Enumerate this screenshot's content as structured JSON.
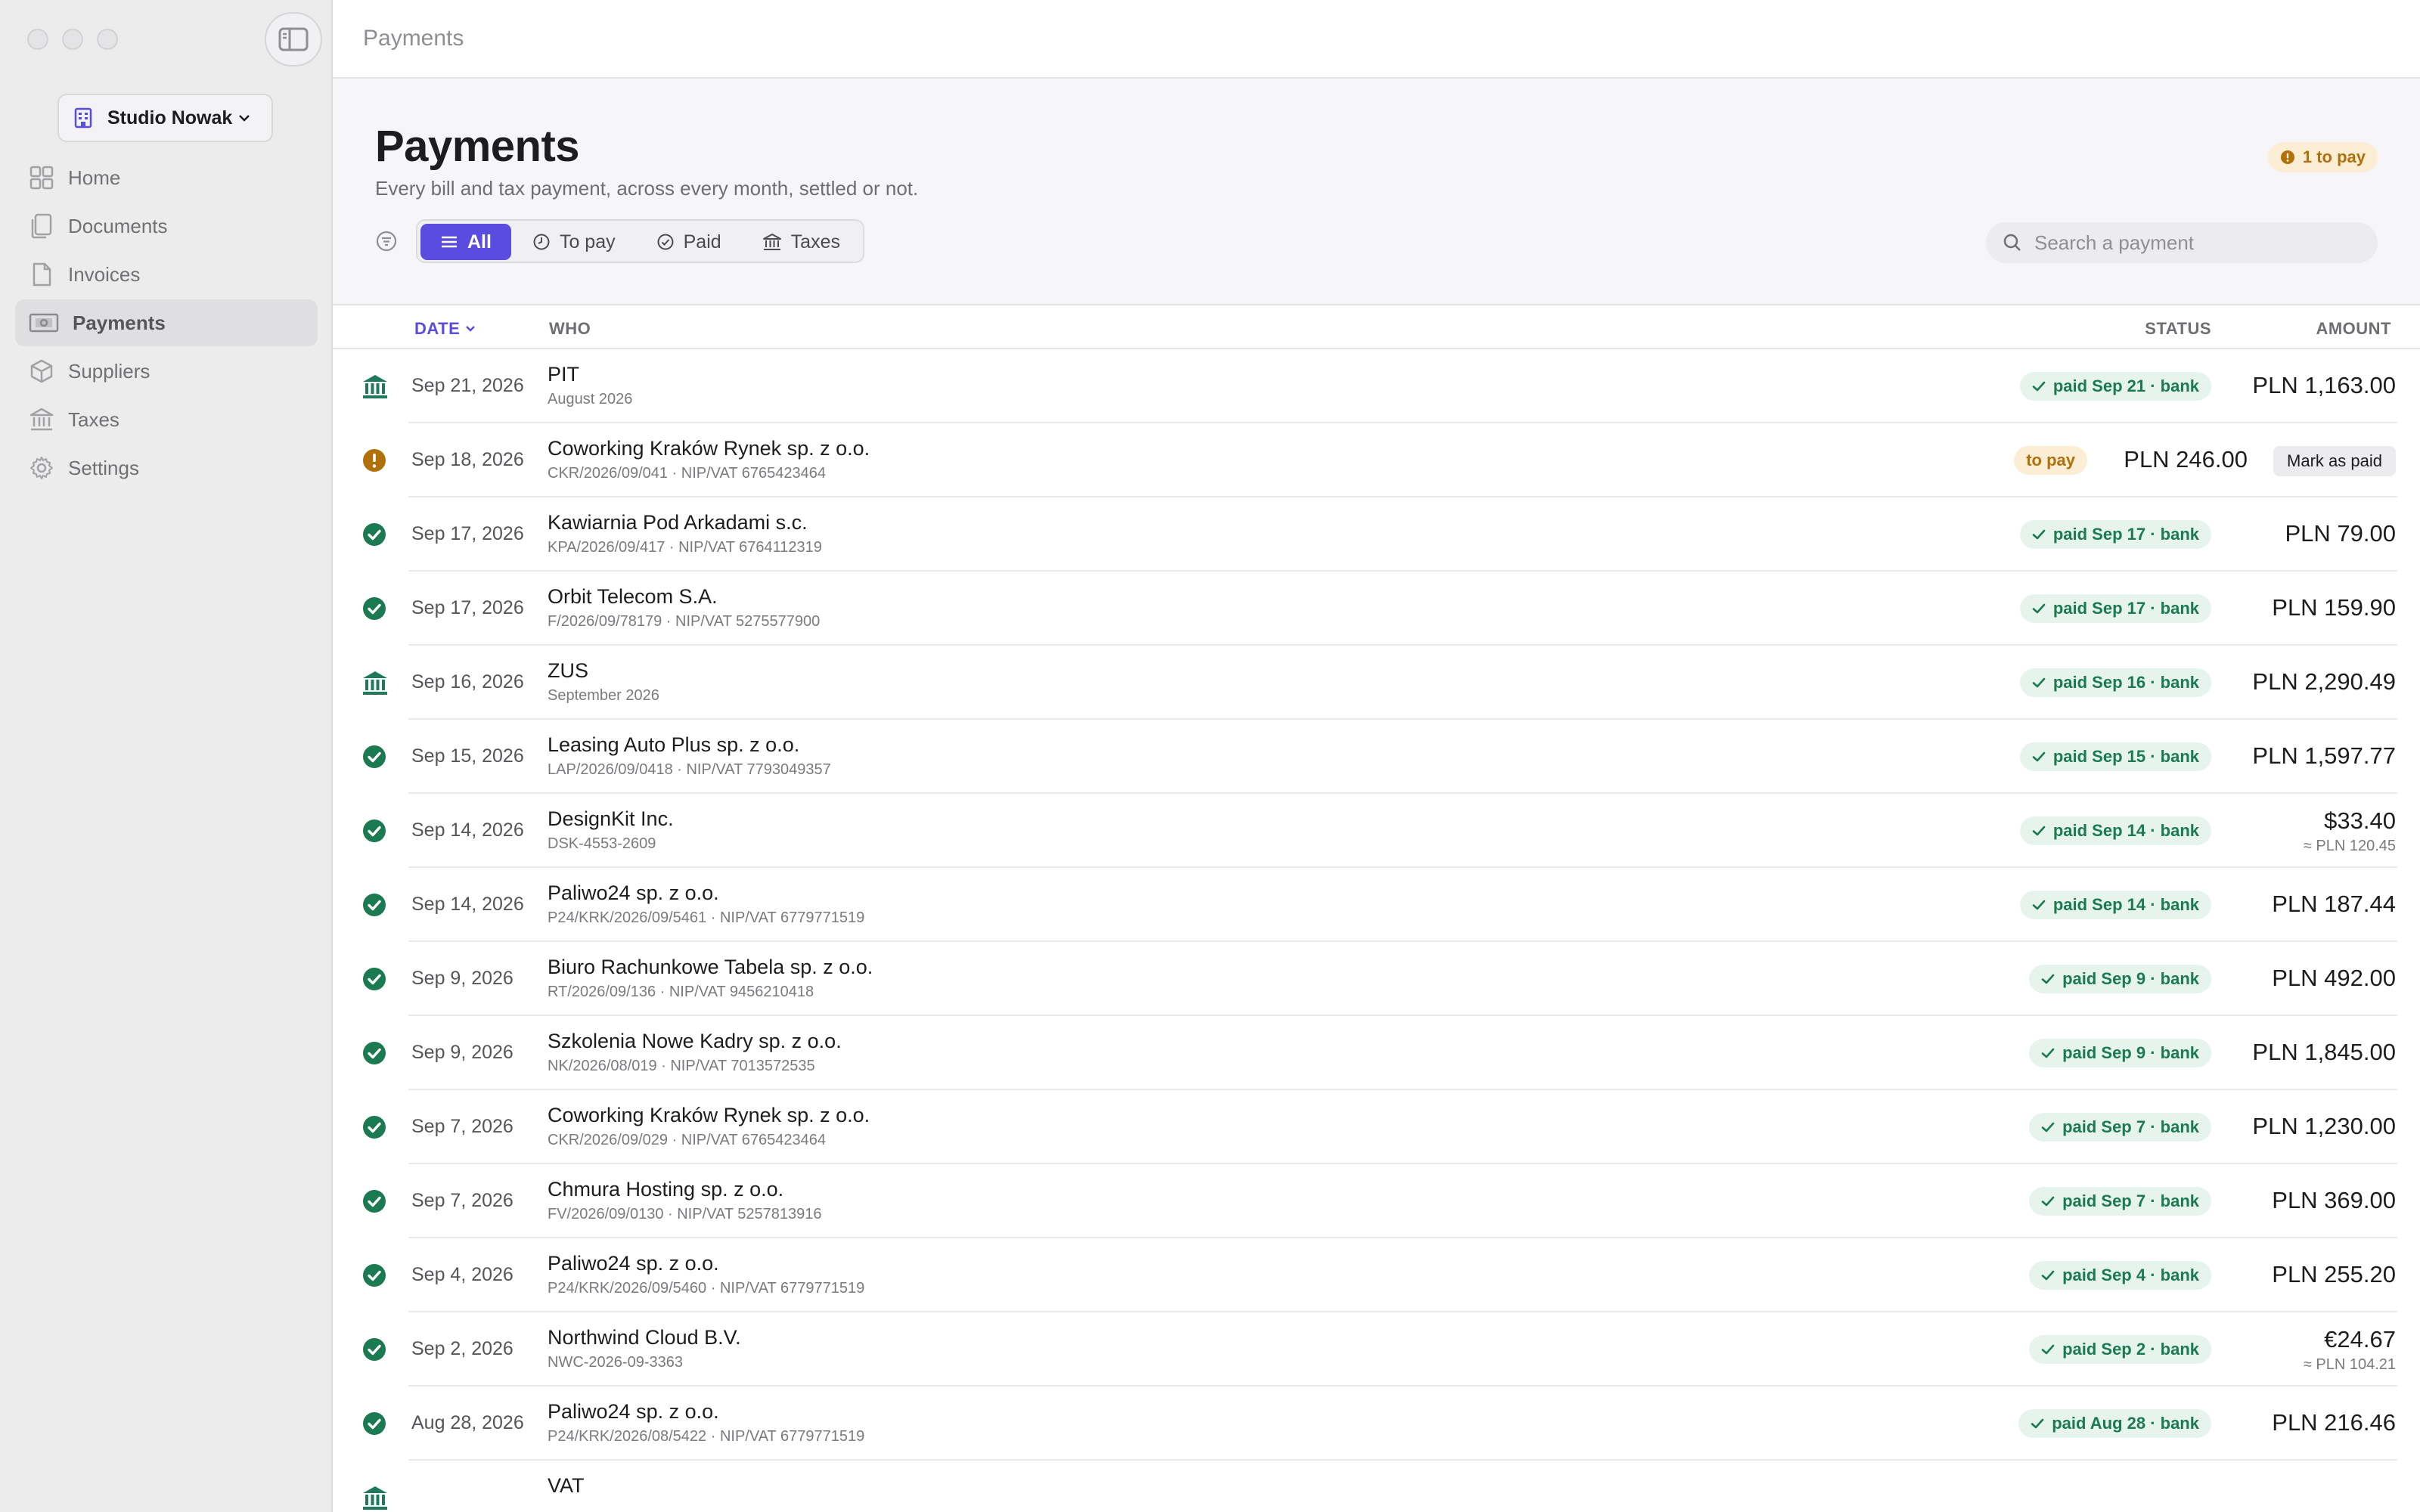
{
  "window": {
    "breadcrumb": "Payments"
  },
  "sidebar": {
    "workspace": "Studio Nowak",
    "items": [
      {
        "label": "Home",
        "icon": "grid-icon"
      },
      {
        "label": "Documents",
        "icon": "documents-icon"
      },
      {
        "label": "Invoices",
        "icon": "invoice-icon"
      },
      {
        "label": "Payments",
        "icon": "banknote-icon",
        "active": true
      },
      {
        "label": "Suppliers",
        "icon": "box-icon"
      },
      {
        "label": "Taxes",
        "icon": "bank-icon"
      },
      {
        "label": "Settings",
        "icon": "gear-icon"
      }
    ]
  },
  "header": {
    "title": "Payments",
    "subtitle": "Every bill and tax payment, across every month, settled or not.",
    "to_pay_badge": "1 to pay",
    "filters": [
      "All",
      "To pay",
      "Paid",
      "Taxes"
    ],
    "search_placeholder": "Search a payment"
  },
  "table": {
    "headers": {
      "date": "DATE",
      "who": "WHO",
      "status": "STATUS",
      "amount": "AMOUNT"
    },
    "mark_paid_label": "Mark as paid",
    "rows": [
      {
        "kind": "tax",
        "date": "Sep 21, 2026",
        "name": "PIT",
        "sub": "August 2026",
        "status": "paid Sep 21 · bank",
        "amount": "PLN 1,163.00"
      },
      {
        "kind": "topay",
        "date": "Sep 18, 2026",
        "name": "Coworking Kraków Rynek sp. z o.o.",
        "sub": "CKR/2026/09/041 · NIP/VAT 6765423464",
        "status": "to pay",
        "amount": "PLN 246.00"
      },
      {
        "kind": "paid",
        "date": "Sep 17, 2026",
        "name": "Kawiarnia Pod Arkadami s.c.",
        "sub": "KPA/2026/09/417 · NIP/VAT 6764112319",
        "status": "paid Sep 17 · bank",
        "amount": "PLN 79.00"
      },
      {
        "kind": "paid",
        "date": "Sep 17, 2026",
        "name": "Orbit Telecom S.A.",
        "sub": "F/2026/09/78179 · NIP/VAT 5275577900",
        "status": "paid Sep 17 · bank",
        "amount": "PLN 159.90"
      },
      {
        "kind": "tax",
        "date": "Sep 16, 2026",
        "name": "ZUS",
        "sub": "September 2026",
        "status": "paid Sep 16 · bank",
        "amount": "PLN 2,290.49"
      },
      {
        "kind": "paid",
        "date": "Sep 15, 2026",
        "name": "Leasing Auto Plus sp. z o.o.",
        "sub": "LAP/2026/09/0418 · NIP/VAT 7793049357",
        "status": "paid Sep 15 · bank",
        "amount": "PLN 1,597.77"
      },
      {
        "kind": "paid",
        "date": "Sep 14, 2026",
        "name": "DesignKit Inc.",
        "sub": "DSK-4553-2609",
        "status": "paid Sep 14 · bank",
        "amount": "$33.40",
        "amount_sub": "≈ PLN 120.45"
      },
      {
        "kind": "paid",
        "date": "Sep 14, 2026",
        "name": "Paliwo24 sp. z o.o.",
        "sub": "P24/KRK/2026/09/5461 · NIP/VAT 6779771519",
        "status": "paid Sep 14 · bank",
        "amount": "PLN 187.44"
      },
      {
        "kind": "paid",
        "date": "Sep 9, 2026",
        "name": "Biuro Rachunkowe Tabela sp. z o.o.",
        "sub": "RT/2026/09/136 · NIP/VAT 9456210418",
        "status": "paid Sep 9 · bank",
        "amount": "PLN 492.00"
      },
      {
        "kind": "paid",
        "date": "Sep 9, 2026",
        "name": "Szkolenia Nowe Kadry sp. z o.o.",
        "sub": "NK/2026/08/019 · NIP/VAT 7013572535",
        "status": "paid Sep 9 · bank",
        "amount": "PLN 1,845.00"
      },
      {
        "kind": "paid",
        "date": "Sep 7, 2026",
        "name": "Coworking Kraków Rynek sp. z o.o.",
        "sub": "CKR/2026/09/029 · NIP/VAT 6765423464",
        "status": "paid Sep 7 · bank",
        "amount": "PLN 1,230.00"
      },
      {
        "kind": "paid",
        "date": "Sep 7, 2026",
        "name": "Chmura Hosting sp. z o.o.",
        "sub": "FV/2026/09/0130 · NIP/VAT 5257813916",
        "status": "paid Sep 7 · bank",
        "amount": "PLN 369.00"
      },
      {
        "kind": "paid",
        "date": "Sep 4, 2026",
        "name": "Paliwo24 sp. z o.o.",
        "sub": "P24/KRK/2026/09/5460 · NIP/VAT 6779771519",
        "status": "paid Sep 4 · bank",
        "amount": "PLN 255.20"
      },
      {
        "kind": "paid",
        "date": "Sep 2, 2026",
        "name": "Northwind Cloud B.V.",
        "sub": "NWC-2026-09-3363",
        "status": "paid Sep 2 · bank",
        "amount": "€24.67",
        "amount_sub": "≈ PLN 104.21"
      },
      {
        "kind": "paid",
        "date": "Aug 28, 2026",
        "name": "Paliwo24 sp. z o.o.",
        "sub": "P24/KRK/2026/08/5422 · NIP/VAT 6779771519",
        "status": "paid Aug 28 · bank",
        "amount": "PLN 216.46"
      },
      {
        "kind": "tax",
        "date": "",
        "name": "VAT",
        "sub": "",
        "status": "",
        "amount": ""
      }
    ]
  },
  "colors": {
    "accent": "#5b4ce0",
    "paid": "#1b7a52",
    "warning": "#b0700a",
    "tax": "#1f7a5c"
  }
}
